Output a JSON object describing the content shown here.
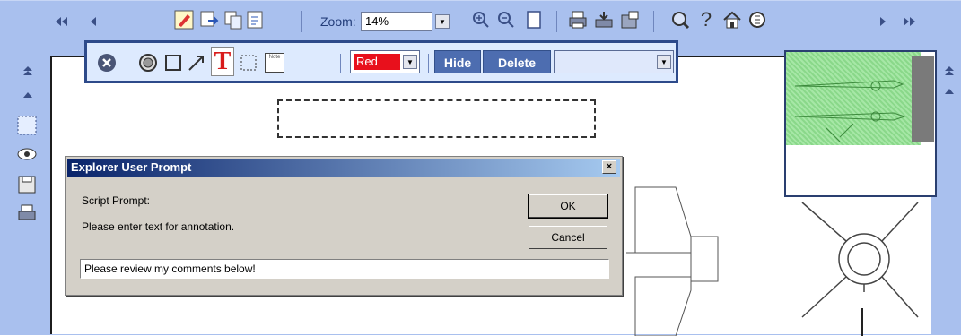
{
  "toolbar": {
    "zoom_label": "Zoom:",
    "zoom_value": "14%",
    "icons": [
      "first-page-icon",
      "previous-page-icon",
      "annotate-icon",
      "compare-icon",
      "copy-icon",
      "export-icon",
      "zoom-in-icon",
      "zoom-out-icon",
      "fit-page-icon",
      "print-icon",
      "print-setup-icon",
      "properties-icon",
      "magnifier-icon",
      "help-icon",
      "home-icon",
      "rotate-icon",
      "next-page-icon",
      "last-page-icon"
    ]
  },
  "annotation_bar": {
    "color_value": "Red",
    "hide_label": "Hide",
    "delete_label": "Delete",
    "text_tool_glyph": "T",
    "note_tool_label": "Note",
    "colors": {
      "border": "#2d4a8a",
      "button": "#4d6db0",
      "red": "#e8101c"
    }
  },
  "dialog": {
    "title": "Explorer User Prompt",
    "close_glyph": "×",
    "script_prompt": "Script Prompt:",
    "message": "Please enter text for annotation.",
    "ok_label": "OK",
    "cancel_label": "Cancel",
    "input_value": "Please review my comments below!"
  },
  "colors": {
    "frame": "#a9c0ee",
    "title_bar_start": "#0a246a",
    "title_bar_end": "#a6caf0"
  }
}
